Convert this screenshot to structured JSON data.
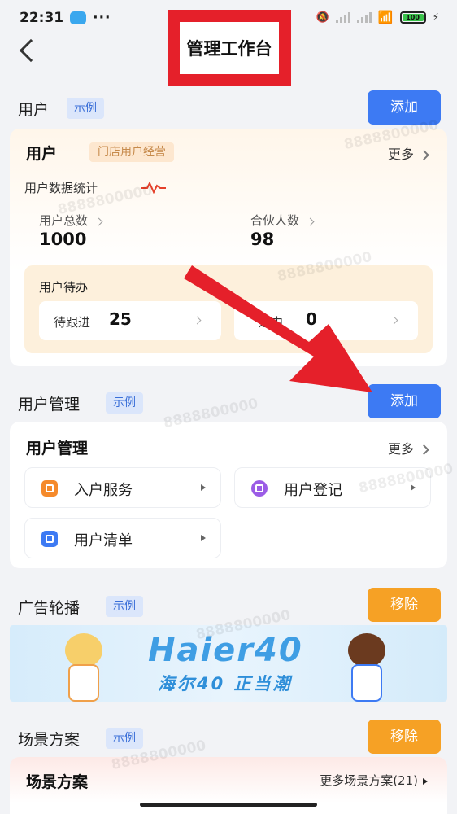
{
  "statusbar": {
    "time": "22:31",
    "dots": "···",
    "battery": "100"
  },
  "header": {
    "title": "管理工作台"
  },
  "section_user": {
    "label": "用户",
    "tag": "示例",
    "button": "添加"
  },
  "user_card": {
    "title": "用户",
    "tag": "门店用户经营",
    "more": "更多",
    "stats_title": "用户数据统计",
    "total_label": "用户总数",
    "total_value": "1000",
    "partner_label": "合伙人数",
    "partner_value": "98",
    "todo_title": "用户待办",
    "todo_follow_label": "待跟进",
    "todo_follow_value": "25",
    "todo_other_label": "进中",
    "todo_other_value": "0"
  },
  "section_mgmt": {
    "label": "用户管理",
    "tag": "示例",
    "button": "添加"
  },
  "mgmt_card": {
    "title": "用户管理",
    "more": "更多",
    "items": [
      {
        "label": "入户服务",
        "icon": "home-service-icon",
        "color": "#f58a2b"
      },
      {
        "label": "用户登记",
        "icon": "register-icon",
        "color": "#9b5ce6"
      },
      {
        "label": "用户清单",
        "icon": "list-icon",
        "color": "#3d7af3"
      }
    ]
  },
  "section_ad": {
    "label": "广告轮播",
    "tag": "示例",
    "button": "移除"
  },
  "banner": {
    "brand": "Haier40",
    "slogan": "海尔40 正当潮"
  },
  "section_scheme": {
    "label": "场景方案",
    "tag": "示例",
    "button": "移除"
  },
  "scheme_card": {
    "title": "场景方案",
    "more": "更多场景方案(21)"
  },
  "watermark": "8888800000",
  "colors": {
    "accent_blue": "#3d7af3",
    "accent_orange": "#f6a125",
    "highlight_red": "#e5202a"
  }
}
